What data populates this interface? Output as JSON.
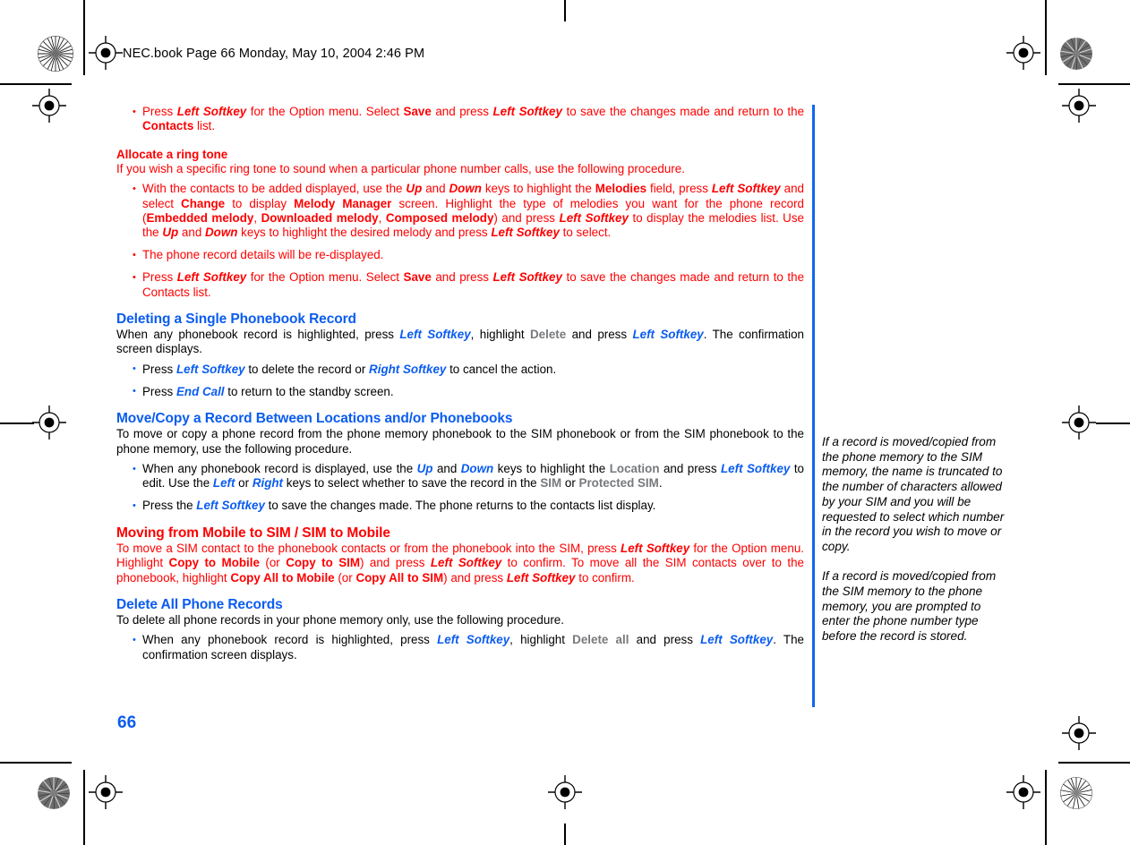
{
  "header": {
    "slug": "NEC.book  Page 66  Monday, May 10, 2004  2:46 PM"
  },
  "colors": {
    "red": "#fe0000",
    "blue": "#0a5cf0",
    "gray": "#77797c",
    "rule_blue": "#1166ee",
    "black": "#000000"
  },
  "folio": {
    "page_number": "66"
  },
  "content": {
    "bullet_save_1": {
      "p1": "Press ",
      "k1": "Left Softkey",
      "p2": " for the Option menu. Select  ",
      "k2": "Save",
      "p3": " and press ",
      "k3": "Left Softkey",
      "p4": " to save the changes made and return to the ",
      "k4": "Contacts",
      "p5": " list."
    },
    "ringtone": {
      "heading": "Allocate a ring tone",
      "intro": "If you wish a specific ring tone to sound when a particular phone number calls, use the following procedure.",
      "bullet1": {
        "p1": "With the contacts to be added displayed, use the ",
        "k1": "Up",
        "p2": " and ",
        "k2": "Down",
        "p3": " keys to highlight the ",
        "k3": "Melodies",
        "p4": " field, press ",
        "k4": "Left Softkey",
        "p5": " and select ",
        "k5": "Change",
        "p6": " to display ",
        "k6": "Melody Manager",
        "p7": " screen. Highlight the type of melodies you want for the phone record (",
        "k7": "Embedded melody",
        "p8": ", ",
        "k8": "Downloaded melody",
        "p9": ", ",
        "k9": "Composed melody",
        "p10": ") and press ",
        "k10": "Left Softkey",
        "p11": " to display the melodies list. Use the ",
        "k11": "Up",
        "p12": " and ",
        "k12": "Down",
        "p13": " keys to highlight the desired melody and press ",
        "k13": "Left Softkey",
        "p14": " to select."
      },
      "bullet2": "The phone record details will be re-displayed.",
      "bullet3": {
        "p1": "Press ",
        "k1": "Left Softkey",
        "p2": " for the Option menu. Select ",
        "k2": "Save",
        "p3": " and press ",
        "k3": "Left Softkey",
        "p4": " to save the changes made and return to the Contacts list."
      }
    },
    "delete_single": {
      "heading": "Deleting a Single Phonebook Record",
      "intro": {
        "p1": "When any phonebook record is highlighted, press ",
        "k1": "Left Softkey",
        "p2": ", highlight ",
        "k2": "Delete",
        "p3": " and press ",
        "k3": "Left Softkey",
        "p4": ". The confirmation screen displays."
      },
      "bullet1": {
        "p1": "Press ",
        "k1": "Left Softkey",
        "p2": " to delete the record or ",
        "k2": "Right Softkey",
        "p3": " to cancel the action."
      },
      "bullet2": {
        "p1": "Press ",
        "k1": "End Call",
        "p2": " to return to the standby screen."
      }
    },
    "move_copy": {
      "heading": "Move/Copy a Record Between Locations and/or Phonebooks",
      "intro": "To move or copy a phone record from the phone memory phonebook to the SIM phonebook or from the SIM phonebook to the phone memory, use the following procedure.",
      "bullet1": {
        "p1": "When any phonebook record is displayed, use the ",
        "k1": "Up",
        "p2": " and ",
        "k2": "Down",
        "p3": " keys to highlight the ",
        "k3": "Location",
        "p4": " and press ",
        "k4": "Left Softkey",
        "p5": " to edit. Use the ",
        "k5": "Left",
        "p6": " or ",
        "k6": "Right",
        "p7": " keys to select whether to save the record in the ",
        "k7": "SIM",
        "p8": " or ",
        "k8": "Protected SIM",
        "p9": "."
      },
      "bullet2": {
        "p1": "Press the ",
        "k1": "Left Softkey",
        "p2": " to save the changes made. The phone returns to the contacts list display."
      }
    },
    "moving_mobile_sim": {
      "heading": "Moving from Mobile to SIM / SIM to Mobile",
      "body": {
        "p1": "To move a SIM contact to the phonebook contacts or from the phonebook into the SIM, press ",
        "k1": "Left Softkey",
        "p2": " for the Option menu. Highlight ",
        "k2": "Copy to Mobile",
        "p3": " (or ",
        "k3": "Copy to SIM",
        "p4": ") and press ",
        "k4": "Left Softkey",
        "p5": " to confirm. To move all the SIM contacts over to the phonebook, highlight ",
        "k5": "Copy All to Mobile",
        "p6": " (or ",
        "k6": "Copy All to SIM",
        "p7": ") and press ",
        "k7": "Left Softkey",
        "p8": " to confirm."
      }
    },
    "delete_all": {
      "heading": "Delete All Phone Records",
      "intro": "To delete all phone records in your phone memory only, use the following procedure.",
      "bullet1": {
        "p1": "When any phonebook record is highlighted, press ",
        "k1": "Left Softkey",
        "p2": ", highlight ",
        "k2": "Delete all",
        "p3": " and press ",
        "k3": "Left Softkey",
        "p4": ". The confirmation screen displays."
      }
    }
  },
  "margin_note": {
    "paragraph1": "If a record is moved/copied from the phone memory to the SIM memory, the name is truncated to the number of characters allowed by your SIM and you will be requested to select which number in the record you wish to move or copy.",
    "paragraph2": "If a record is moved/copied from the SIM memory to the phone memory, you are prompted to enter the phone number type before the record is stored."
  },
  "print_marks": {
    "registration_target_icon": "registration-target-icon",
    "starburst_icon": "starburst-calibration-icon"
  }
}
